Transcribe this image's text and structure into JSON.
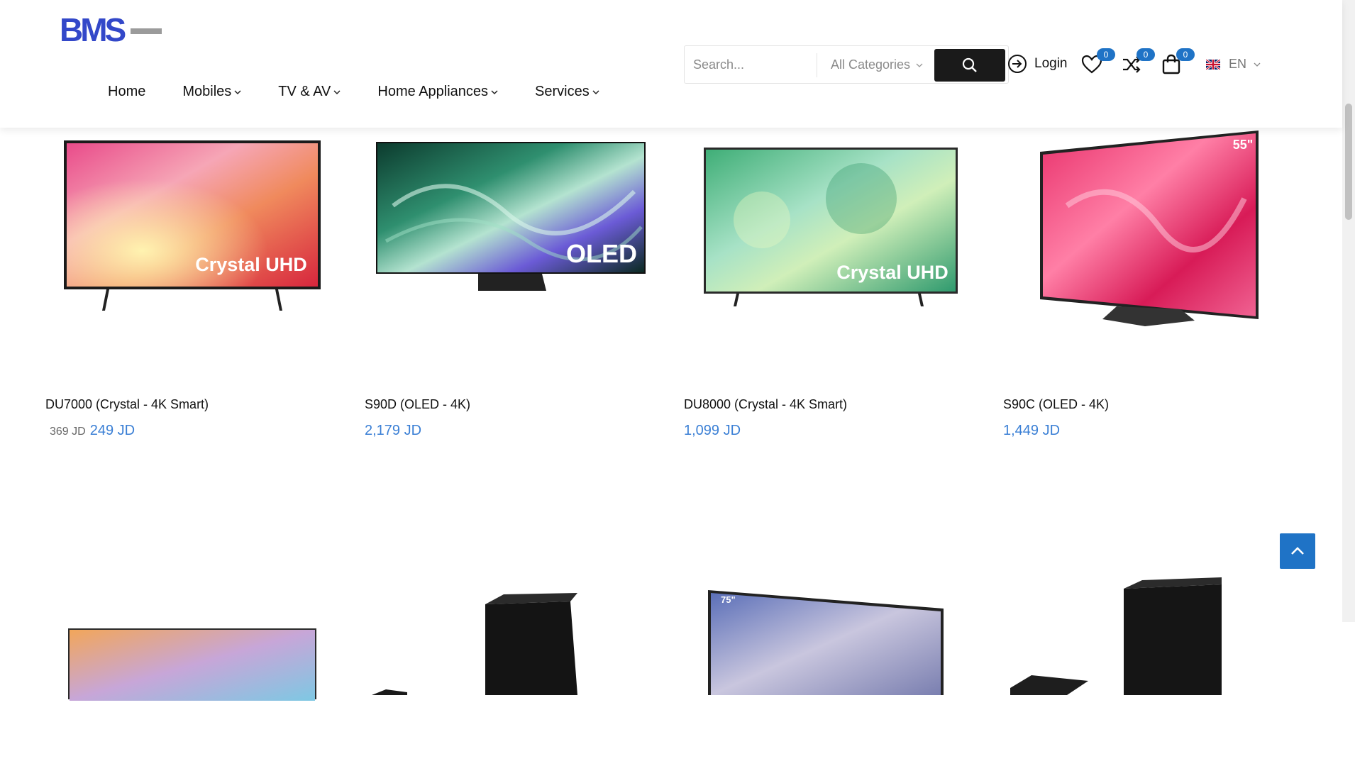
{
  "brand": {
    "logo_text": "BMS",
    "primary_color": "#3348c9",
    "secondary_color": "#8a8a8a"
  },
  "nav": {
    "items": [
      {
        "label": "Home",
        "has_dropdown": false
      },
      {
        "label": "Mobiles",
        "has_dropdown": true
      },
      {
        "label": "TV & AV",
        "has_dropdown": true
      },
      {
        "label": "Home Appliances",
        "has_dropdown": true
      },
      {
        "label": "Services",
        "has_dropdown": true
      }
    ]
  },
  "search": {
    "placeholder": "Search...",
    "category_label": "All Categories",
    "button_icon": "search-icon"
  },
  "account": {
    "login_label": "Login",
    "login_icon": "login-icon"
  },
  "counters": {
    "wishlist": "0",
    "compare": "0",
    "cart": "0"
  },
  "language": {
    "code": "EN",
    "flag": "uk-flag"
  },
  "products": [
    {
      "name": "DU7000 (Crystal - 4K Smart)",
      "old_price": "369 JD",
      "price": "249 JD",
      "screen_text": "Crystal UHD"
    },
    {
      "name": "S90D (OLED - 4K)",
      "old_price": "",
      "price": "2,179 JD",
      "screen_text": "OLED"
    },
    {
      "name": "DU8000 (Crystal - 4K Smart)",
      "old_price": "",
      "price": "1,099 JD",
      "screen_text": "Crystal UHD"
    },
    {
      "name": "S90C (OLED - 4K)",
      "old_price": "",
      "price": "1,449 JD",
      "screen_text": "55\""
    }
  ],
  "second_row": {
    "tv_badge": "75\""
  },
  "colors": {
    "accent_blue": "#1f73c6",
    "price_blue": "#3a7fd5",
    "dark_button": "#1a1a1a"
  }
}
